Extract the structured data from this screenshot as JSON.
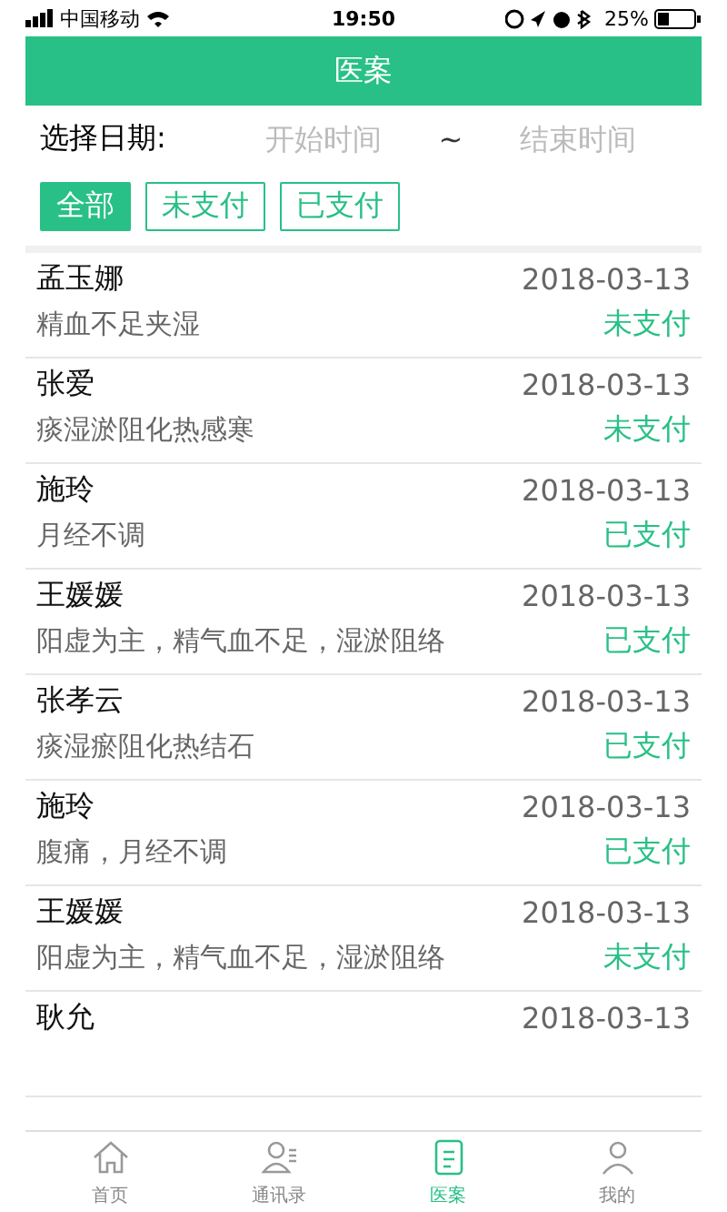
{
  "status_bar": {
    "carrier": "中国移动",
    "time": "19:50",
    "battery": "25%"
  },
  "header": {
    "title": "医案"
  },
  "date_filter": {
    "label": "选择日期:",
    "start_placeholder": "开始时间",
    "separator": "~",
    "end_placeholder": "结束时间"
  },
  "filters": [
    {
      "label": "全部",
      "selected": true
    },
    {
      "label": "未支付",
      "selected": false
    },
    {
      "label": "已支付",
      "selected": false
    }
  ],
  "records": [
    {
      "name": "孟玉娜",
      "date": "2018-03-13",
      "diagnosis": "精血不足夹湿",
      "status": "未支付"
    },
    {
      "name": "张爱",
      "date": "2018-03-13",
      "diagnosis": "痰湿淤阻化热感寒",
      "status": "未支付"
    },
    {
      "name": "施玲",
      "date": "2018-03-13",
      "diagnosis": "月经不调",
      "status": "已支付"
    },
    {
      "name": "王媛媛",
      "date": "2018-03-13",
      "diagnosis": "阳虚为主，精气血不足，湿淤阻络",
      "status": "已支付"
    },
    {
      "name": "张孝云",
      "date": "2018-03-13",
      "diagnosis": "痰湿瘀阻化热结石",
      "status": "已支付"
    },
    {
      "name": "施玲",
      "date": "2018-03-13",
      "diagnosis": "腹痛，月经不调",
      "status": "已支付"
    },
    {
      "name": "王媛媛",
      "date": "2018-03-13",
      "diagnosis": "阳虚为主，精气血不足，湿淤阻络",
      "status": "未支付"
    },
    {
      "name": "耿允",
      "date": "2018-03-13"
    }
  ],
  "tab_bar": [
    {
      "label": "首页",
      "kind": "home",
      "selected": false
    },
    {
      "label": "通讯录",
      "kind": "contacts",
      "selected": false
    },
    {
      "label": "医案",
      "kind": "records",
      "selected": true
    },
    {
      "label": "我的",
      "kind": "profile",
      "selected": false
    }
  ]
}
